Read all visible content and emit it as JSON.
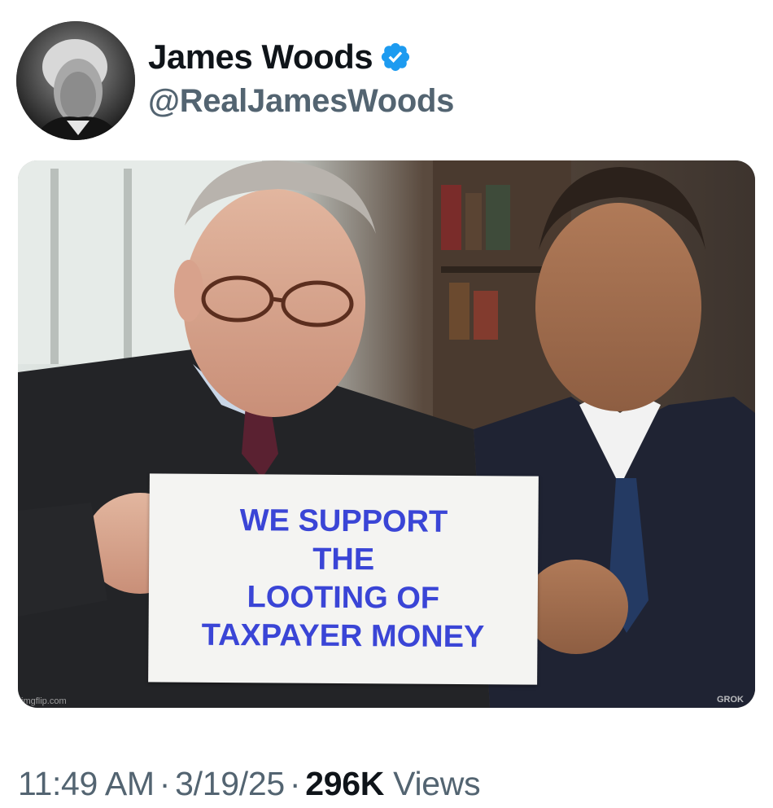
{
  "author": {
    "display_name": "James Woods",
    "handle": "@RealJamesWoods",
    "verified_icon": "verified-badge-icon",
    "verified_color": "#1d9bf0"
  },
  "media": {
    "sign_lines": [
      "WE SUPPORT",
      "THE",
      "LOOTING OF",
      "TAXPAYER MONEY"
    ],
    "sign_text_color": "#3a45d6",
    "watermark_left": "imgflip.com",
    "watermark_right": "GROK"
  },
  "meta": {
    "time": "11:49 AM",
    "separator": "·",
    "date": "3/19/25",
    "views_count": "296K",
    "views_label": "Views"
  }
}
